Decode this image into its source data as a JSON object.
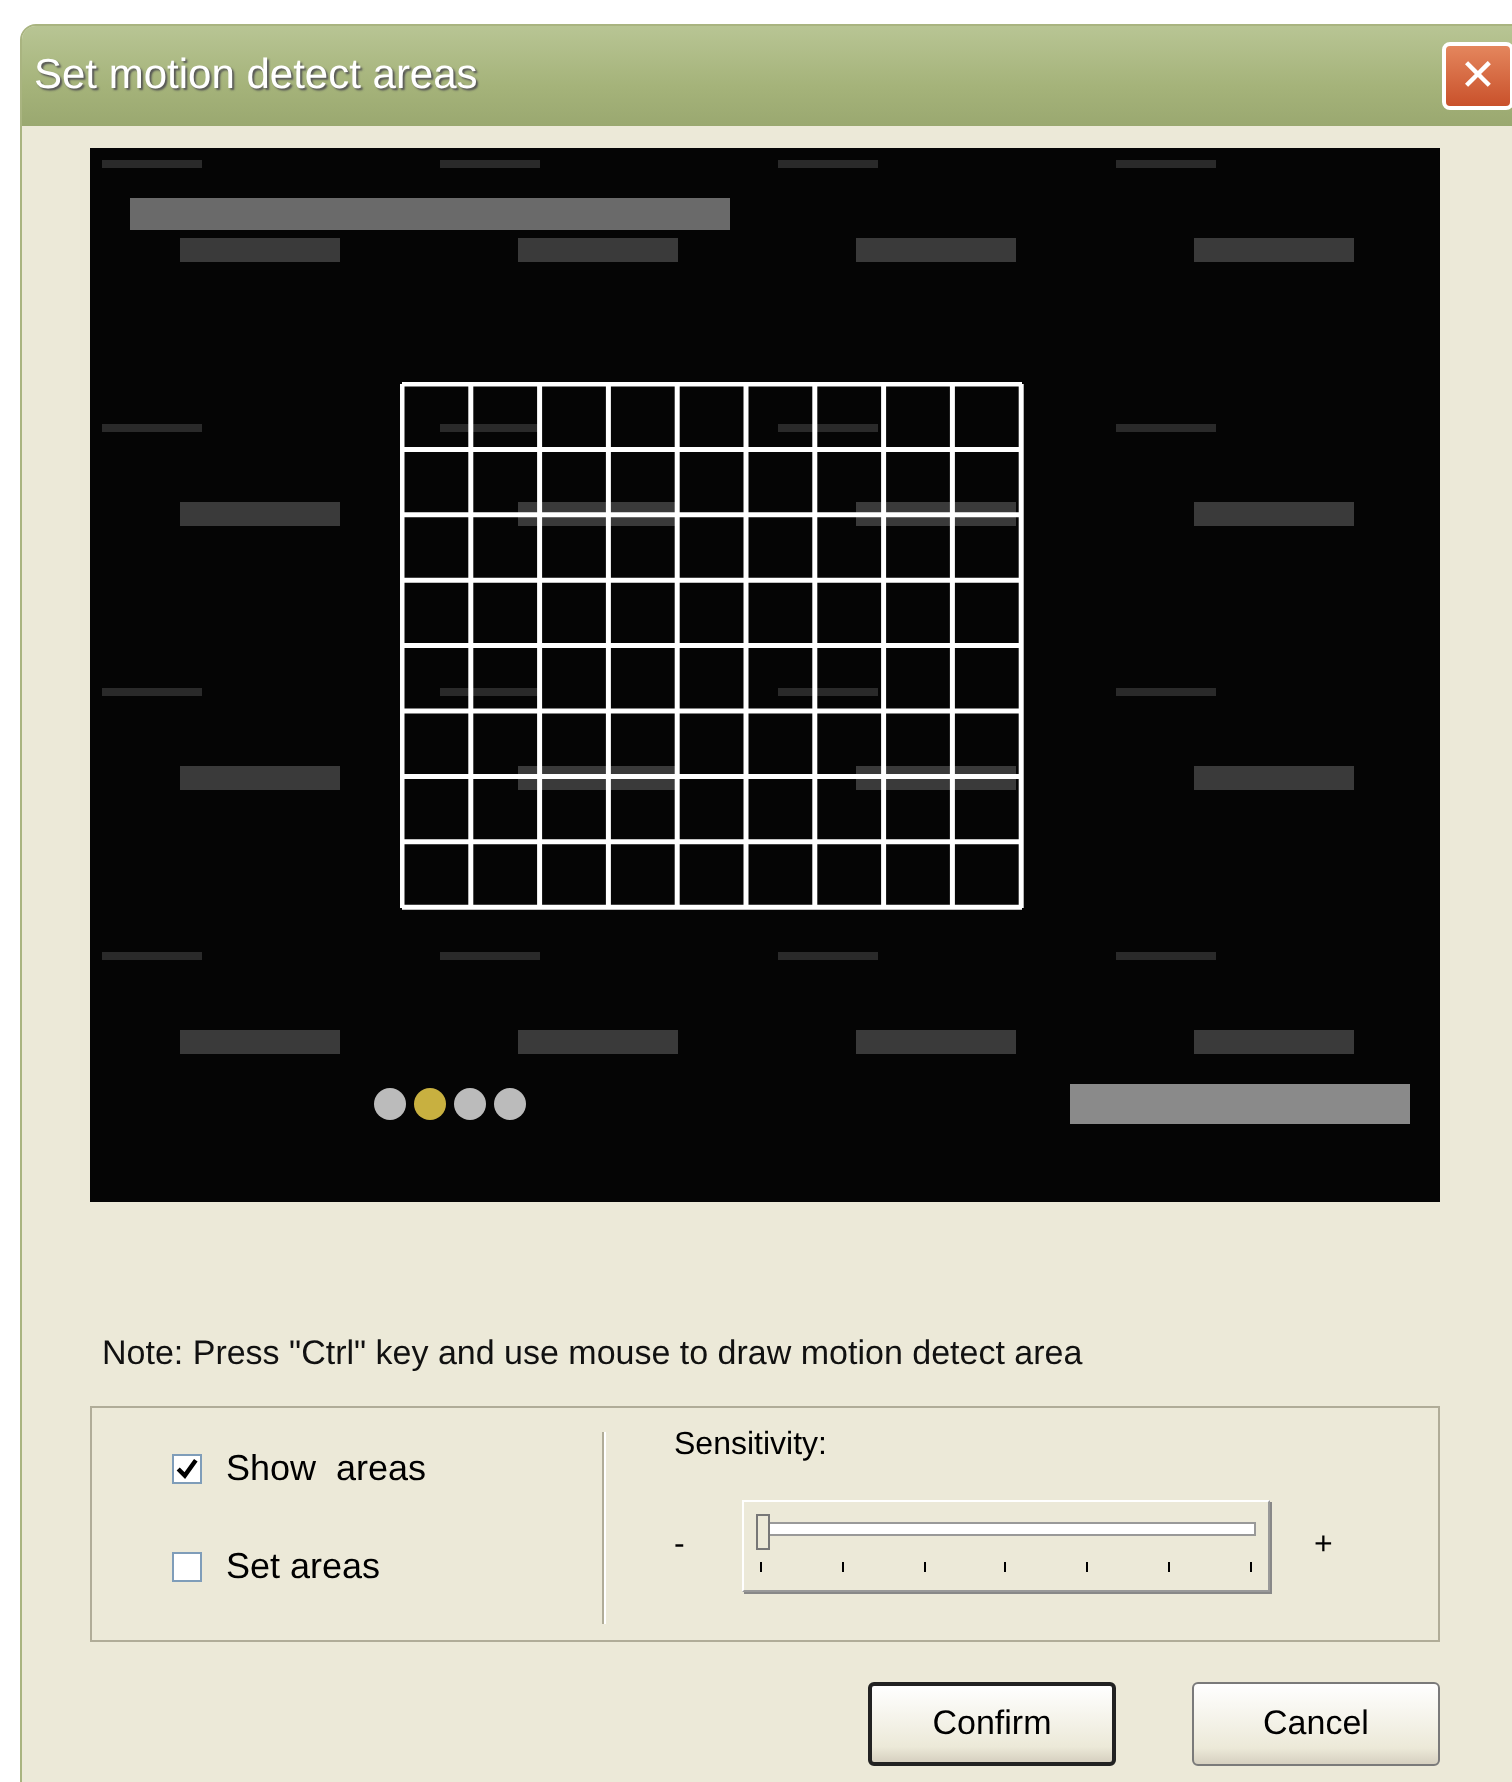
{
  "window": {
    "title": "Set motion detect areas",
    "close": "✕"
  },
  "note": "Note: Press \"Ctrl\" key and use mouse to draw motion detect area",
  "options": [
    {
      "label": "Show  areas",
      "checked": true
    },
    {
      "label": "Set areas",
      "checked": false
    }
  ],
  "sensitivity": {
    "label": "Sensitivity:",
    "minus": "-",
    "plus": "+",
    "level": 0
  },
  "buttons": [
    {
      "label": "Confirm",
      "default": true
    },
    {
      "label": "Cancel",
      "default": false
    }
  ]
}
